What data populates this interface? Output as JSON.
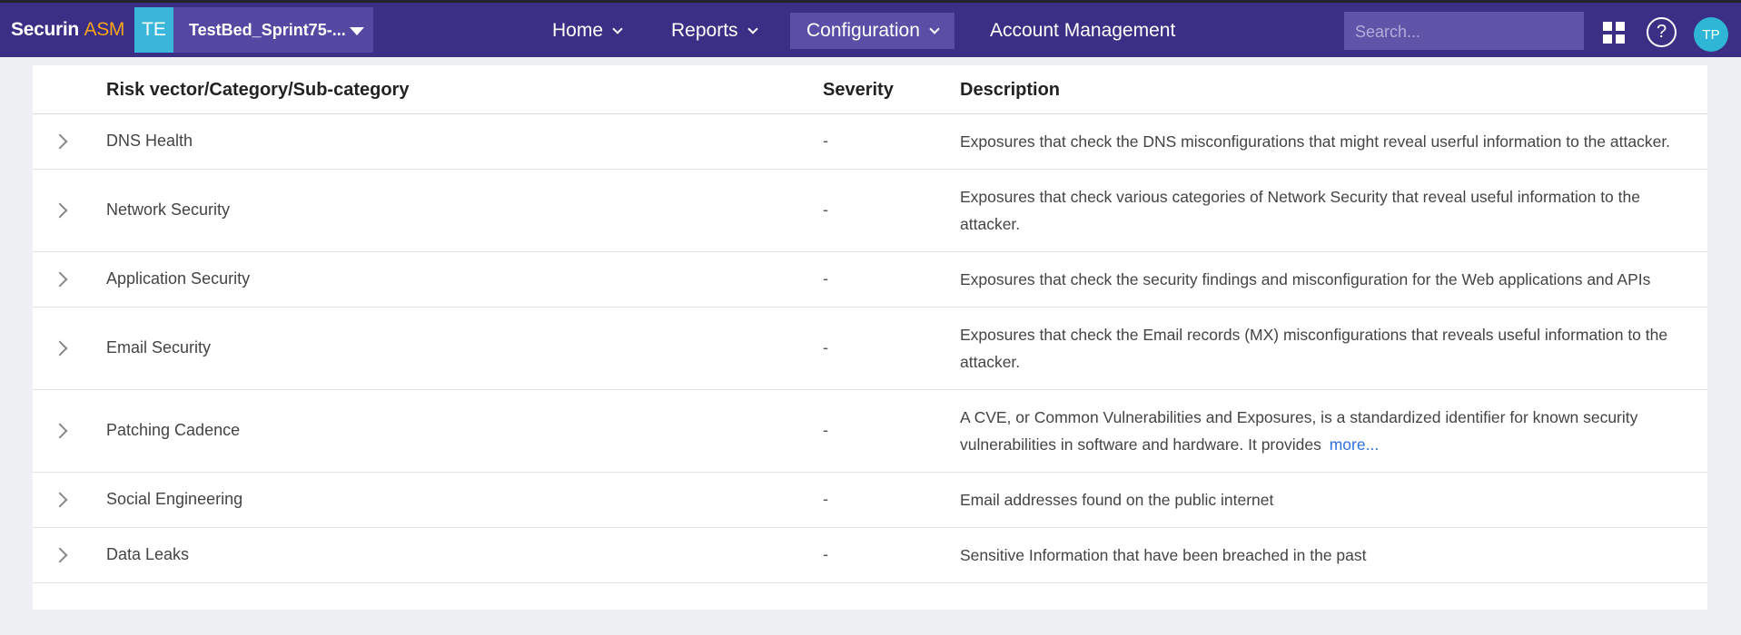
{
  "header": {
    "logo_main": "Securin",
    "logo_suffix": "ASM",
    "project_badge": "TE",
    "project_name": "TestBed_Sprint75-...",
    "nav": {
      "home": "Home",
      "reports": "Reports",
      "configuration": "Configuration",
      "account": "Account Management"
    },
    "search_placeholder": "Search...",
    "help": "?",
    "avatar": "TP"
  },
  "table": {
    "columns": {
      "category": "Risk vector/Category/Sub-category",
      "severity": "Severity",
      "description": "Description"
    },
    "rows": [
      {
        "name": "DNS Health",
        "severity": "-",
        "description": "Exposures that check the DNS misconfigurations that might reveal userful information to the attacker."
      },
      {
        "name": "Network Security",
        "severity": "-",
        "description": "Exposures that check various categories of Network Security that reveal useful information to the attacker."
      },
      {
        "name": "Application Security",
        "severity": "-",
        "description": "Exposures that check the security findings and misconfiguration for the Web applications and APIs"
      },
      {
        "name": "Email Security",
        "severity": "-",
        "description": "Exposures that check the Email records (MX) misconfigurations that reveals useful information to the attacker."
      },
      {
        "name": "Patching Cadence",
        "severity": "-",
        "description": "A CVE, or Common Vulnerabilities and Exposures, is a standardized identifier for known security vulnerabilities in software and hardware. It provides",
        "more": "more..."
      },
      {
        "name": "Social Engineering",
        "severity": "-",
        "description": "Email addresses found on the public internet"
      },
      {
        "name": "Data Leaks",
        "severity": "-",
        "description": "Sensitive Information that have been breached in the past"
      }
    ]
  }
}
